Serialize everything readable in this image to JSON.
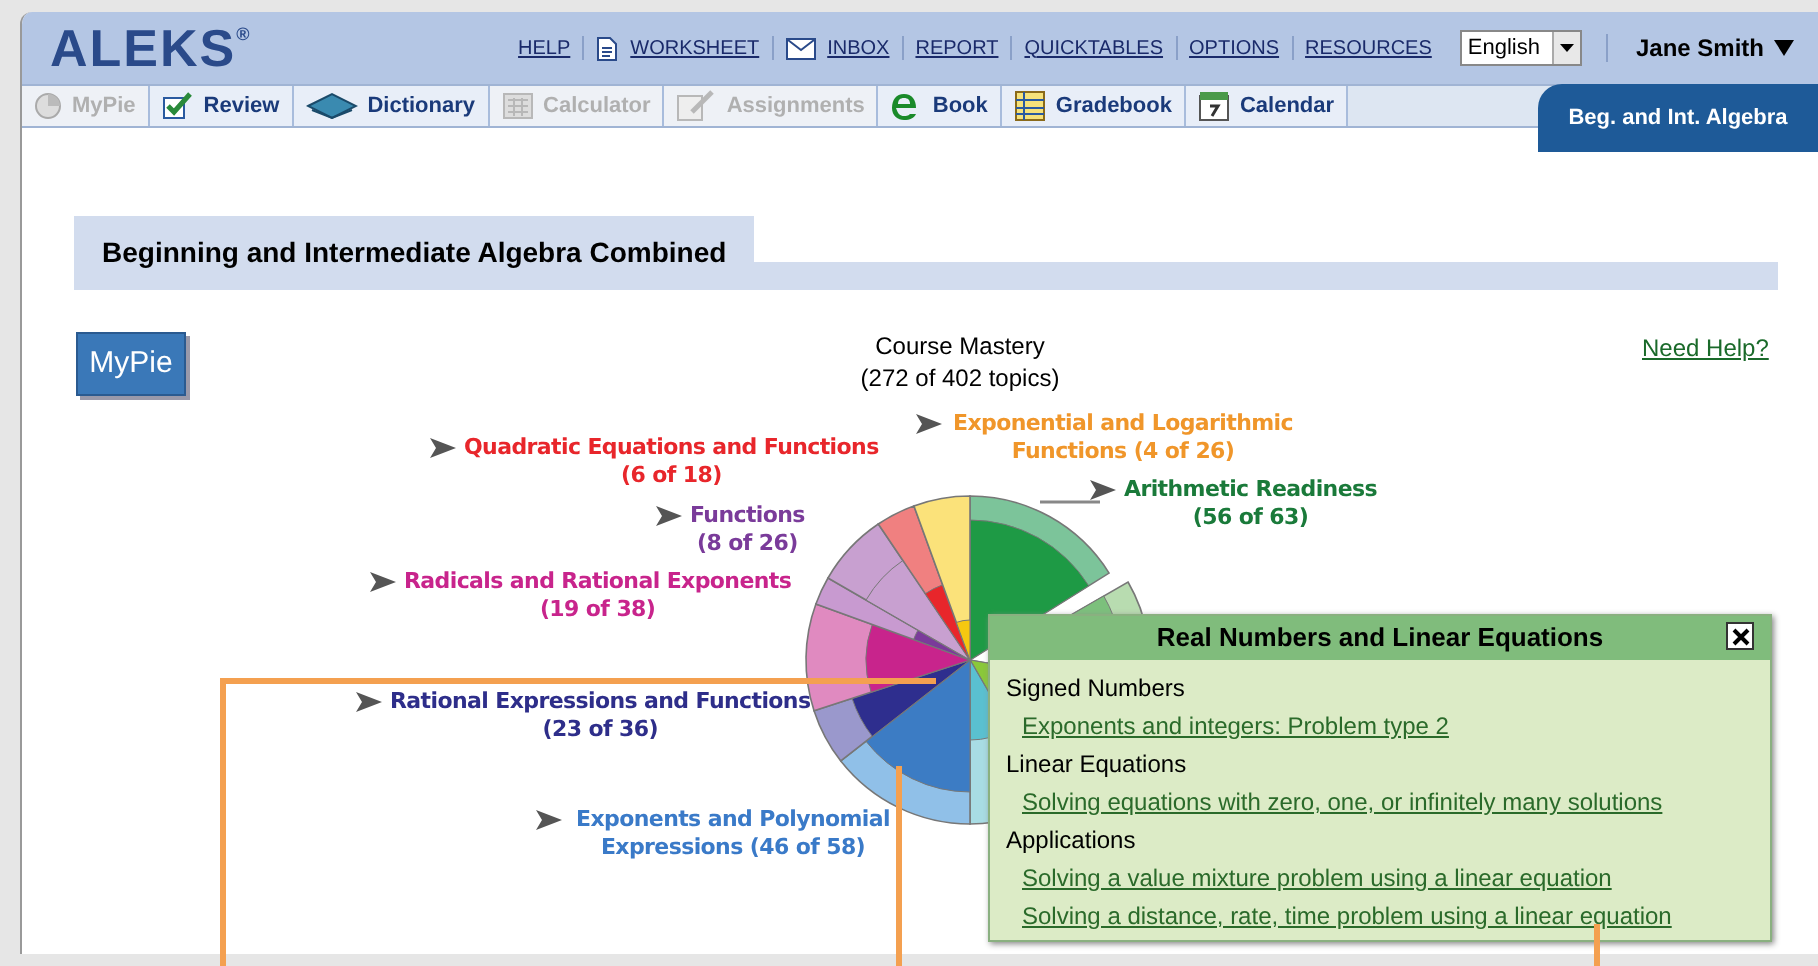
{
  "header": {
    "logo": "ALEKS",
    "logo_mark": "®",
    "links": [
      {
        "label": "HELP"
      },
      {
        "label": "WORKSHEET"
      },
      {
        "label": "INBOX"
      },
      {
        "label": "REPORT"
      },
      {
        "label": "QUICKTABLES"
      },
      {
        "label": "OPTIONS"
      },
      {
        "label": "RESOURCES"
      }
    ],
    "language": "English",
    "user": "Jane Smith"
  },
  "tabs": [
    {
      "label": "MyPie",
      "disabled": true
    },
    {
      "label": "Review",
      "disabled": false
    },
    {
      "label": "Dictionary",
      "disabled": false
    },
    {
      "label": "Calculator",
      "disabled": true
    },
    {
      "label": "Assignments",
      "disabled": true
    },
    {
      "label": "Book",
      "disabled": false
    },
    {
      "label": "Gradebook",
      "disabled": false
    },
    {
      "label": "Calendar",
      "disabled": false
    }
  ],
  "course_tab": {
    "label": "Beg. and Int. Algebra",
    "selected": true
  },
  "page_title": "Beginning and Intermediate Algebra Combined",
  "mypie_button": "MyPie",
  "mastery": {
    "title": "Course Mastery",
    "count": "(272 of 402 topics)"
  },
  "help_link": "Need Help?",
  "pie_labels": [
    {
      "kind": "stacked",
      "name": "Quadratic Equations and Functions",
      "count": "(6 of 18)",
      "color": "#e8262b"
    },
    {
      "kind": "wrapped",
      "name": "Exponential and Logarithmic Functions",
      "count": "(4 of 26)",
      "color": "#f0962a"
    },
    {
      "kind": "stacked",
      "name": "Arithmetic Readiness",
      "count": "(56 of 63)",
      "color": "#1a7a3a"
    },
    {
      "kind": "stacked",
      "name": "Functions",
      "count": "(8 of 26)",
      "color": "#7a3b9a"
    },
    {
      "kind": "stacked",
      "name": "Radicals and Rational Exponents",
      "count": "(19 of 38)",
      "color": "#c8248c"
    },
    {
      "kind": "stacked",
      "name": "Rational Expressions and Functions",
      "count": "(23 of 36)",
      "color": "#2e2e8a"
    },
    {
      "kind": "wrapped",
      "name": "Exponents and Polynomial Expressions",
      "count": "(46 of 58)",
      "color": "#3a7ac8"
    }
  ],
  "popup": {
    "title": "Real Numbers and Linear Equations",
    "sections": [
      {
        "heading": "Signed Numbers",
        "links": [
          "Exponents and integers: Problem type 2"
        ]
      },
      {
        "heading": "Linear Equations",
        "links": [
          "Solving equations with zero, one, or infinitely many solutions"
        ]
      },
      {
        "heading": "Applications",
        "links": [
          "Solving a value mixture problem using a linear equation",
          "Solving a distance, rate, time problem using a linear equation"
        ]
      }
    ]
  }
}
